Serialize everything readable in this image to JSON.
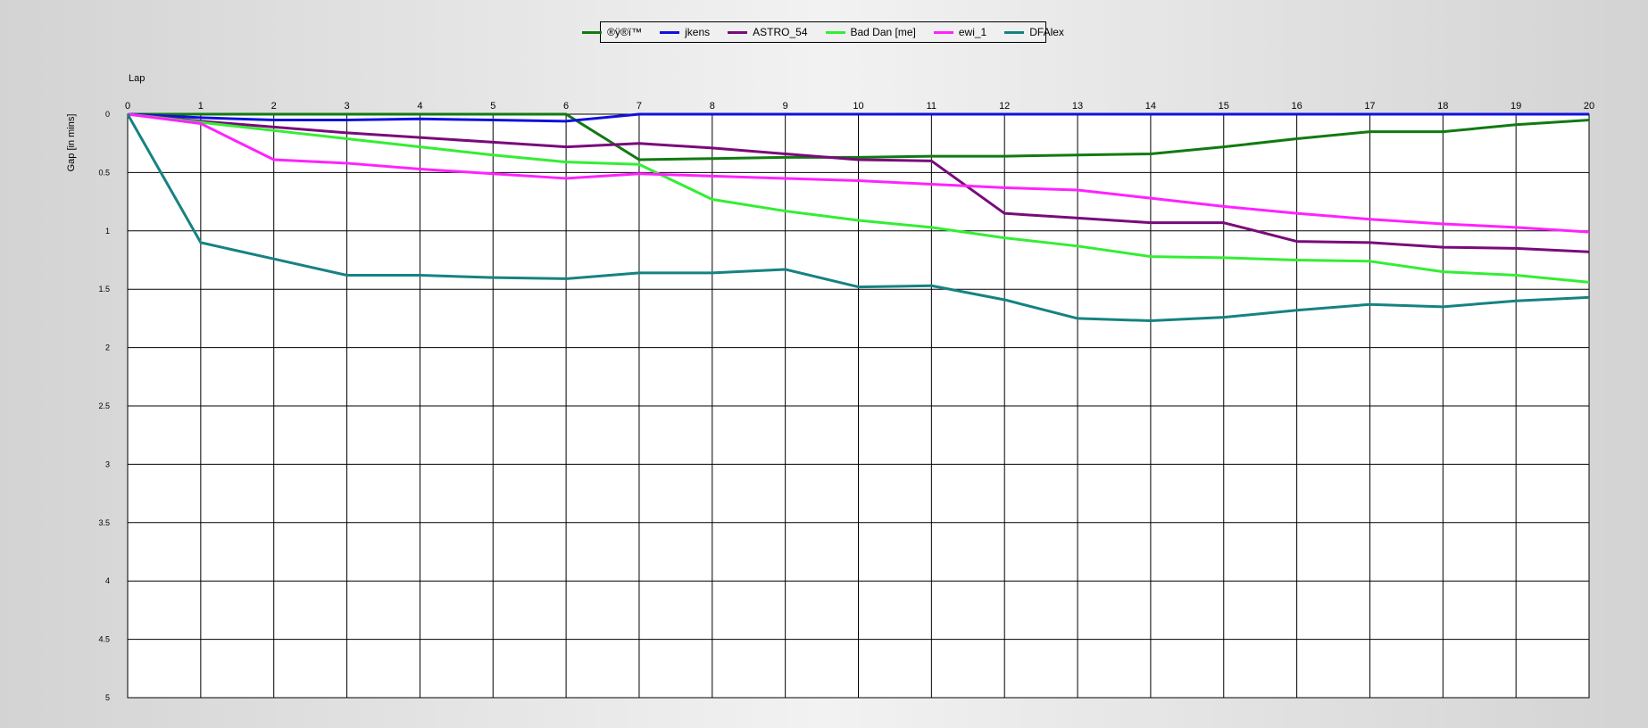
{
  "chart_data": {
    "type": "line",
    "title": "",
    "xlabel": "Lap",
    "ylabel": "Gap [in mins]",
    "x": [
      0,
      1,
      2,
      3,
      4,
      5,
      6,
      7,
      8,
      9,
      10,
      11,
      12,
      13,
      14,
      15,
      16,
      17,
      18,
      19,
      20
    ],
    "xlim": [
      0,
      20
    ],
    "ylim": [
      0,
      5
    ],
    "y_inverted": true,
    "yticks": [
      0,
      0.5,
      1,
      1.5,
      2,
      2.5,
      3,
      3.5,
      4,
      4.5,
      5
    ],
    "ytick_labels": [
      "0",
      "0.5",
      "1",
      "1.5",
      "2",
      "2.5",
      "3",
      "3.5",
      "4",
      "4.5",
      "5"
    ],
    "grid": true,
    "legend_position": "top-center",
    "series": [
      {
        "name": "®ÿ®ï™",
        "color": "#117a11",
        "values": [
          0,
          0,
          0,
          0,
          0,
          0,
          0,
          0.39,
          0.38,
          0.37,
          0.37,
          0.36,
          0.36,
          0.35,
          0.34,
          0.28,
          0.21,
          0.15,
          0.15,
          0.09,
          0.05
        ]
      },
      {
        "name": "jkens",
        "color": "#1010e0",
        "values": [
          0,
          0.03,
          0.05,
          0.05,
          0.04,
          0.05,
          0.06,
          0,
          0,
          0,
          0,
          0,
          0,
          0,
          0,
          0,
          0,
          0,
          0,
          0,
          0
        ]
      },
      {
        "name": "ASTRO_54",
        "color": "#7a0a7a",
        "values": [
          0,
          0.06,
          0.11,
          0.16,
          0.2,
          0.24,
          0.28,
          0.25,
          0.29,
          0.34,
          0.39,
          0.4,
          0.85,
          0.89,
          0.93,
          0.93,
          1.09,
          1.1,
          1.14,
          1.15,
          1.18
        ]
      },
      {
        "name": "Bad Dan [me]",
        "color": "#33ee33",
        "values": [
          0,
          0.07,
          0.14,
          0.21,
          0.28,
          0.35,
          0.41,
          0.43,
          0.73,
          0.83,
          0.91,
          0.97,
          1.06,
          1.13,
          1.22,
          1.23,
          1.25,
          1.26,
          1.35,
          1.38,
          1.44
        ]
      },
      {
        "name": "ewi_1",
        "color": "#ff22ff",
        "values": [
          0,
          0.08,
          0.39,
          0.42,
          0.47,
          0.51,
          0.55,
          0.51,
          0.53,
          0.55,
          0.57,
          0.6,
          0.63,
          0.65,
          0.72,
          0.79,
          0.85,
          0.9,
          0.94,
          0.97,
          1.01
        ]
      },
      {
        "name": "DFAlex",
        "color": "#168282",
        "values": [
          0,
          1.1,
          1.24,
          1.38,
          1.38,
          1.4,
          1.41,
          1.36,
          1.36,
          1.33,
          1.48,
          1.47,
          1.59,
          1.75,
          1.77,
          1.74,
          1.68,
          1.63,
          1.65,
          1.6,
          1.57
        ]
      }
    ]
  }
}
